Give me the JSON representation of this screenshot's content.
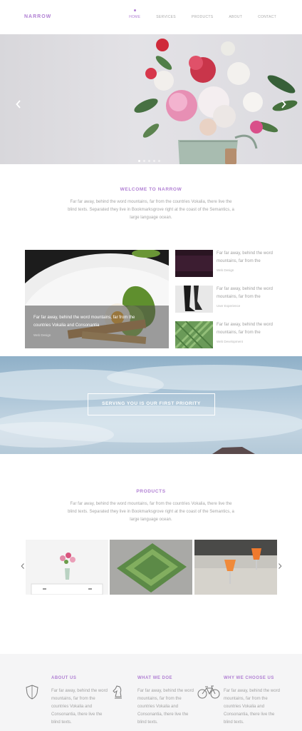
{
  "brand": {
    "logo": "NARROW",
    "accent": "#b07fd3"
  },
  "nav": {
    "items": [
      {
        "label": "HOME",
        "active": true
      },
      {
        "label": "SERVICES",
        "active": false
      },
      {
        "label": "PRODUCTS",
        "active": false
      },
      {
        "label": "ABOUT",
        "active": false
      },
      {
        "label": "CONTACT",
        "active": false
      }
    ]
  },
  "hero": {
    "prev_icon": "chevron-left-icon",
    "next_icon": "chevron-right-icon",
    "dots": 5,
    "active_dot": 1
  },
  "welcome": {
    "title": "WELCOME TO NARROW",
    "text": "Far far away, behind the word mountains, far from the countries Vokalia, there live the blind texts. Separated they live in Bookmarksgrove right at the coast of the Semantics, a large language ocean."
  },
  "features": {
    "main": {
      "caption": "Far far away, behind the word mountains, far from the countries Vokalia and Consonantia",
      "tag": "Web Design"
    },
    "items": [
      {
        "text": "Far far away, behind the word mountains, far from the",
        "tag": "Web Design"
      },
      {
        "text": "Far far away, behind the word mountains, far from the",
        "tag": "User Experience"
      },
      {
        "text": "Far far away, behind the word mountains, far from the",
        "tag": "Web Development"
      }
    ]
  },
  "banner": {
    "button_label": "SERVING YOU IS OUR FIRST PRIORITY"
  },
  "products": {
    "title": "PRODUCTS",
    "text": "Far far away, behind the word mountains, far from the countries Vokalia, there live the blind texts. Separated they live in Bookmarksgrove right at the coast of the Semantics, a large language ocean.",
    "prev_icon": "chevron-left-icon",
    "next_icon": "chevron-right-icon"
  },
  "footer": {
    "columns": [
      {
        "title": "ABOUT US",
        "icon": "shield-icon",
        "text": "Far far away, behind the word mountains, far from the countries Vokalia and Consonantia, there live the blind texts."
      },
      {
        "title": "WHAT WE DOE",
        "icon": "chess-knight-icon",
        "text": "Far far away, behind the word mountains, far from the countries Vokalia and Consonantia, there live the blind texts."
      },
      {
        "title": "WHY WE CHOOSE US",
        "icon": "bicycle-icon",
        "text": "Far far away, behind the word mountains, far from the countries Vokalia and Consonantia, there live the blind texts."
      }
    ]
  }
}
